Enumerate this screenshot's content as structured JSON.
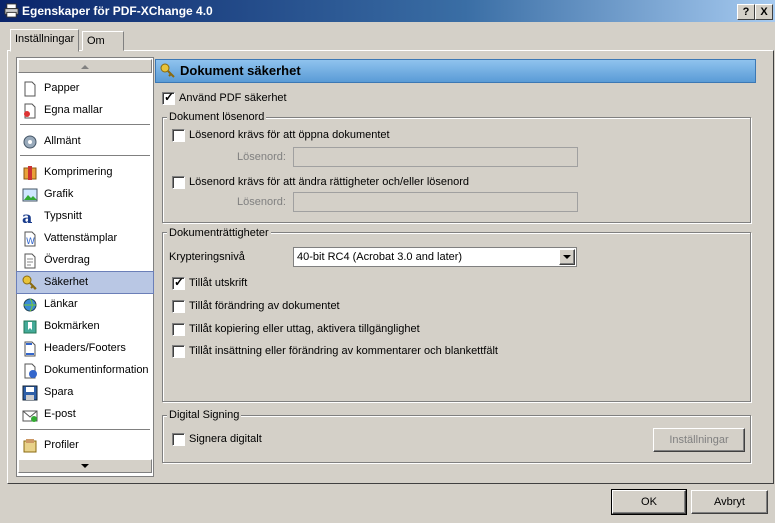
{
  "window": {
    "title": "Egenskaper för PDF-XChange 4.0",
    "help_label": "?",
    "close_label": "X"
  },
  "tabs": [
    {
      "label": "Inställningar"
    },
    {
      "label": "Om"
    }
  ],
  "sidebar": {
    "items": [
      {
        "label": "Papper",
        "icon": "paper-icon"
      },
      {
        "label": "Egna mallar",
        "icon": "custom-template-icon"
      },
      {
        "label": "Allmänt",
        "icon": "general-icon"
      },
      {
        "label": "Komprimering",
        "icon": "compression-icon"
      },
      {
        "label": "Grafik",
        "icon": "graphics-icon"
      },
      {
        "label": "Typsnitt",
        "icon": "font-icon"
      },
      {
        "label": "Vattenstämplar",
        "icon": "watermark-icon"
      },
      {
        "label": "Överdrag",
        "icon": "overlay-icon"
      },
      {
        "label": "Säkerhet",
        "icon": "security-icon",
        "selected": true
      },
      {
        "label": "Länkar",
        "icon": "links-icon"
      },
      {
        "label": "Bokmärken",
        "icon": "bookmarks-icon"
      },
      {
        "label": "Headers/Footers",
        "icon": "headers-footers-icon"
      },
      {
        "label": "Dokumentinformation",
        "icon": "document-info-icon"
      },
      {
        "label": "Spara",
        "icon": "save-icon"
      },
      {
        "label": "E-post",
        "icon": "email-icon"
      },
      {
        "label": "Profiler",
        "icon": "profiles-icon"
      }
    ]
  },
  "content": {
    "title": "Dokument säkerhet",
    "use_security": {
      "label": "Använd PDF säkerhet",
      "checked": true
    },
    "passwords": {
      "legend": "Dokument lösenord",
      "open_required": {
        "label": "Lösenord krävs för att öppna dokumentet",
        "checked": false
      },
      "open_password_label": "Lösenord:",
      "change_required": {
        "label": "Lösenord krävs för att ändra rättigheter och/eller lösenord",
        "checked": false
      },
      "change_password_label": "Lösenord:"
    },
    "permissions": {
      "legend": "Dokumenträttigheter",
      "encryption_label": "Krypteringsnivå",
      "encryption_value": "40-bit RC4 (Acrobat 3.0 and later)",
      "options": [
        {
          "label": "Tillåt utskrift",
          "checked": true
        },
        {
          "label": "Tillåt förändring av dokumentet",
          "checked": false
        },
        {
          "label": "Tillåt kopiering eller uttag, aktivera tillgänglighet",
          "checked": false
        },
        {
          "label": "Tillåt insättning eller förändring av kommentarer och blankettfält",
          "checked": false
        }
      ]
    },
    "signing": {
      "legend": "Digital Signing",
      "sign": {
        "label": "Signera digitalt",
        "checked": false
      },
      "settings_button": "Inställningar"
    }
  },
  "footer": {
    "ok_label": "OK",
    "cancel_label": "Avbryt"
  }
}
